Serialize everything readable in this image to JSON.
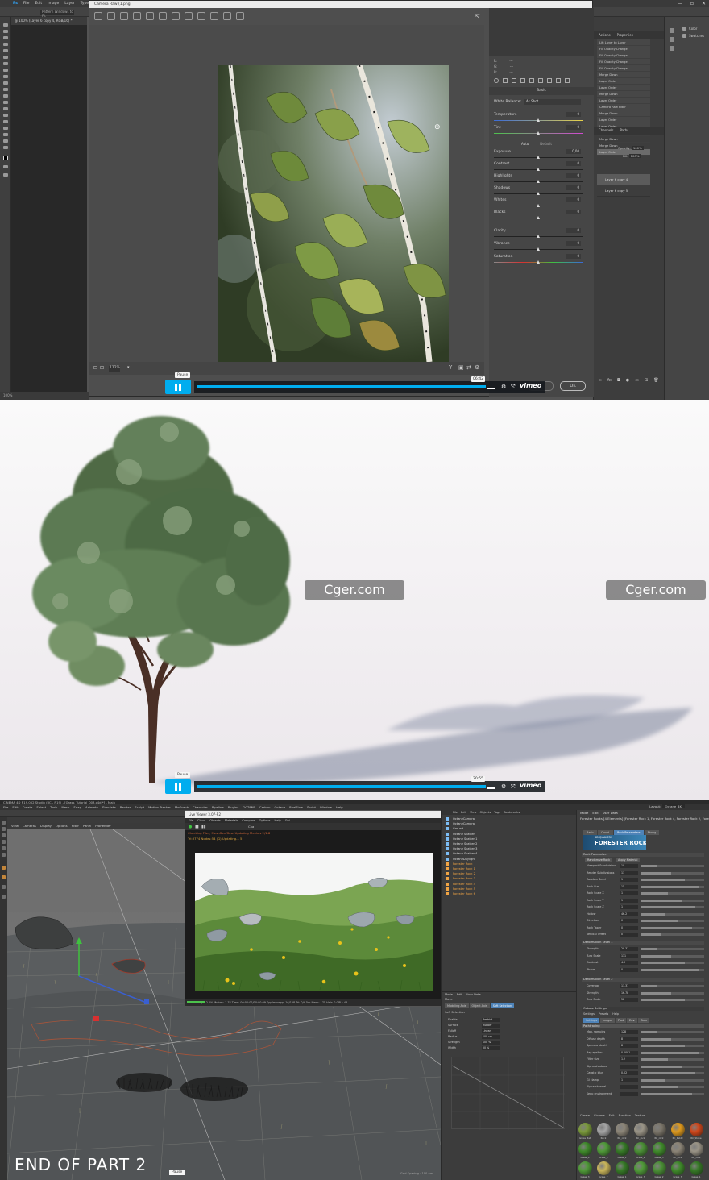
{
  "panel1": {
    "menu": [
      "Ps",
      "File",
      "Edit",
      "Image",
      "Layer",
      "Type",
      "Select",
      "Filter"
    ],
    "options_field": "Pattern Windows to Fit",
    "doc_tab": "@ 100% (Layer 6 copy 4, RGB/16) *",
    "status": "100%",
    "camera_raw": {
      "title": "Camera Raw (1.png)",
      "zoom": "112%",
      "rgb": [
        "R:",
        "G:",
        "B:"
      ],
      "rgb_values": [
        "---",
        "---",
        "---"
      ],
      "section": "Basic",
      "white_balance_label": "White Balance:",
      "white_balance_value": "As Shot",
      "auto": "Auto",
      "default": "Default",
      "sliders": [
        {
          "label": "Temperature",
          "value": "0"
        },
        {
          "label": "Tint",
          "value": "0"
        },
        {
          "label": "Exposure",
          "value": "0,00"
        },
        {
          "label": "Contrast",
          "value": "0"
        },
        {
          "label": "Highlights",
          "value": "0"
        },
        {
          "label": "Shadows",
          "value": "0"
        },
        {
          "label": "Whites",
          "value": "0"
        },
        {
          "label": "Blacks",
          "value": "0"
        },
        {
          "label": "Clarity",
          "value": "0"
        },
        {
          "label": "Vibrance",
          "value": "0"
        },
        {
          "label": "Saturation",
          "value": "0"
        }
      ],
      "ok": "OK"
    },
    "history_tabs": [
      "Actions",
      "Properties"
    ],
    "history": [
      "Lift Layer to Layer",
      "Fill Opacity Change",
      "Fill Opacity Change",
      "Fill Opacity Change",
      "Fill Opacity Change",
      "Merge Down",
      "Layer Order",
      "Layer Order",
      "Merge Down",
      "Layer Order",
      "Camera Raw Filter",
      "Merge Down",
      "Layer Order",
      "Layer Order",
      "Alien/FX Transmogrifier",
      "Merge Down",
      "Merge Down",
      "Layer Order"
    ],
    "layer_tabs": [
      "Channels",
      "Paths"
    ],
    "opacity_label": "Opacity:",
    "opacity_value": "100%",
    "fill_label": "Fill:",
    "fill_value": "100%",
    "layers": [
      "Layer 6 copy 4",
      "Layer 6 copy 5"
    ],
    "far_panel": [
      "Color",
      "Swatches"
    ],
    "vimeo": {
      "tooltip": "Pause",
      "time": "06:42",
      "logo": "vimeo"
    }
  },
  "panel2": {
    "watermark_left": "Cger.com",
    "watermark_right": "Cger.com",
    "vimeo": {
      "tooltip": "Pause",
      "time": "20:55",
      "logo": "vimeo"
    }
  },
  "panel3": {
    "title": "CINEMA 4D R19.052 Studio (RC - R19) - [Grass_Tutorial_003.c4d *] - Main",
    "menu": [
      "File",
      "Edit",
      "Create",
      "Select",
      "Tools",
      "Mesh",
      "Snap",
      "Animate",
      "Simulate",
      "Render",
      "Sculpt",
      "Motion Tracker",
      "MoGraph",
      "Character",
      "Pipeline",
      "Plugins",
      "OCTANE",
      "Carbon",
      "Octane",
      "RealFlow",
      "Script",
      "Window",
      "Help"
    ],
    "layout_label": "Layout:",
    "layout_value": "Octane_4K",
    "viewport_menu": [
      "View",
      "Cameras",
      "Display",
      "Options",
      "Filter",
      "Panel",
      "ProRender"
    ],
    "octane": {
      "title": "Live Viewer 3.07-R2",
      "menu": [
        "File",
        "Cloud",
        "Objects",
        "Materials",
        "Compare",
        "Options",
        "Help",
        "Gui"
      ],
      "channel_label": "Cha",
      "status1": "Checking Files, MeshGen/Geo: Updating Meshes 2/1.8",
      "status2": "Tri:3774 Nodes:54 (G) Updating... 5",
      "footer": "Rendering: 12.0%   Ms/sec: 1.78   Time: 00:00:02/00:00:09   Spp/maxspp: 16/128   Tri: 0/4.5m   Mesh: 175   Hair: 0   GPU: 43"
    },
    "objects": [
      "OctaneCamera",
      "OctaneCamera",
      "Ground",
      "Octane Scatter",
      "Octane Scatter 1",
      "Octane Scatter 2",
      "Octane Scatter 3",
      "Octane Scatter 4",
      "OctaneDaylight",
      "Forester Rock",
      "Forester Rock 1",
      "Forester Rock 2",
      "Forester Rock 3",
      "Forester Rock 4",
      "Forester Rock 5",
      "Forester Rock 6"
    ],
    "om_menu": [
      "File",
      "Edit",
      "View",
      "Objects",
      "Tags",
      "Bookmarks"
    ],
    "attr": {
      "menu": [
        "Mode",
        "Edit",
        "User Data"
      ],
      "header": "Forester Rocks [4 Elements] (Forester Rock 1, Forester Rock 4, Forester Rock 2, Forest...]",
      "tabs": [
        "Basic",
        "Coord.",
        "Rock Parameters",
        "Phong"
      ],
      "logo_small": "3D QUAKERS",
      "logo": "FORESTER ROCK",
      "section1": "Rock Parameters",
      "sub_tabs": [
        "Randomize Rock",
        "Apply Material"
      ],
      "rows1": [
        {
          "label": "Viewport Subdivisions",
          "value": "10"
        },
        {
          "label": "Render Subdivisions",
          "value": "11"
        },
        {
          "label": "Random Seed",
          "value": "1"
        },
        {
          "label": "Rock Size",
          "value": "15"
        },
        {
          "label": "Rock Scale X",
          "value": "1"
        },
        {
          "label": "Rock Scale Y",
          "value": "1"
        },
        {
          "label": "Rock Scale Z",
          "value": "1"
        },
        {
          "label": "Hollow",
          "value": "46.2"
        },
        {
          "label": "Direction",
          "value": "0"
        },
        {
          "label": "Rock Taper",
          "value": "0"
        },
        {
          "label": "Vertical Offset",
          "value": "0"
        }
      ],
      "section2": "Deformation Level 1",
      "rows2": [
        {
          "label": "Strength",
          "value": "29.31"
        },
        {
          "label": "Turb Scale",
          "value": "131"
        },
        {
          "label": "Contrast",
          "value": "4.3"
        },
        {
          "label": "Phase",
          "value": "0"
        }
      ],
      "section3": "Deformation Level 2",
      "rows3": [
        {
          "label": "Coverage",
          "value": "11.37"
        },
        {
          "label": "Strength",
          "value": "16.78"
        },
        {
          "label": "Turb Scale",
          "value": "58"
        }
      ]
    },
    "octane_settings": {
      "title": "Octane Settings",
      "menu": [
        "Settings",
        "Presets",
        "Help"
      ],
      "tabs": [
        "Settings",
        "Imager",
        "Post",
        "Env.",
        "Cam"
      ],
      "kernel": "Pathtracing",
      "rows": [
        {
          "label": "Max. samples",
          "value": "128"
        },
        {
          "label": "Diffuse depth",
          "value": "8"
        },
        {
          "label": "Specular depth",
          "value": "8"
        },
        {
          "label": "Ray epsilon",
          "value": "0.0001"
        },
        {
          "label": "Filter size",
          "value": "1.2"
        },
        {
          "label": "Alpha shadows",
          "value": ""
        },
        {
          "label": "Caustic blur",
          "value": "0.02"
        },
        {
          "label": "GI clamp",
          "value": "1"
        },
        {
          "label": "Alpha channel",
          "value": ""
        },
        {
          "label": "Keep environment",
          "value": ""
        }
      ]
    },
    "coord": {
      "menu": [
        "Mode",
        "Edit",
        "User Data"
      ],
      "mode": "Move",
      "tabs": [
        "Modeling Axis",
        "Object Axis",
        "Soft Selection"
      ],
      "section": "Soft Selection",
      "rows": [
        {
          "label": "Enable",
          "value": "Restrict"
        },
        {
          "label": "Surface",
          "value": "Rubber"
        },
        {
          "label": "Falloff",
          "value": "Linear"
        },
        {
          "label": "Radius",
          "value": "100 cm"
        },
        {
          "label": "Strength",
          "value": "100 %"
        },
        {
          "label": "Width",
          "value": "50 %"
        }
      ]
    },
    "materials_menu": [
      "Create",
      "Cinema",
      "Edit",
      "Function",
      "Texture"
    ],
    "materials": [
      "Grass Mat",
      "Rock",
      "RC_rock",
      "RC_rock",
      "RC_rock",
      "RC_Pebbl",
      "RC_Stone",
      "Grass_4",
      "Grass_3",
      "Grass_1",
      "Grass_2",
      "Grass_3",
      "RC_rock",
      "RC_rock",
      "Grass_3",
      "Grass_7",
      "Grass_1",
      "Grass_3",
      "Grass_2",
      "Grass_3",
      "Grass_1"
    ],
    "grid_spacing": "Grid Spacing : 100 cm",
    "end_text": "END OF PART 2",
    "tooltip": "Pause"
  },
  "colors": {
    "accent": "#00adef",
    "selection": "#f0a444"
  }
}
